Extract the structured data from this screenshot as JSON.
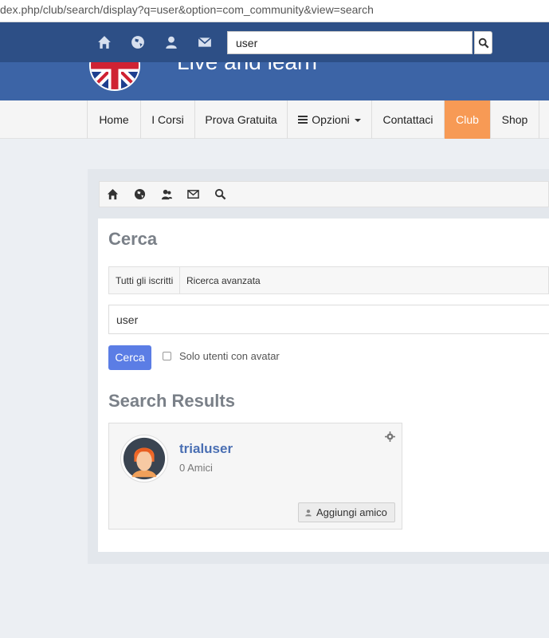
{
  "browser": {
    "url": "dex.php/club/search/display?q=user&option=com_community&view=search"
  },
  "topbar": {
    "icons": [
      "home-icon",
      "globe-icon",
      "user-icon",
      "mail-icon"
    ],
    "search_value": "user",
    "search_button_icon": "search-icon"
  },
  "brand": {
    "slogan": "Live and learn"
  },
  "nav": {
    "items": [
      {
        "label": "Home"
      },
      {
        "label": "I Corsi"
      },
      {
        "label": "Prova Gratuita"
      },
      {
        "label": "Opzioni"
      },
      {
        "label": "Contattaci"
      },
      {
        "label": "Club"
      },
      {
        "label": "Shop"
      }
    ],
    "active_color": "#f79a55"
  },
  "community_toolbar": {
    "icons": [
      "home-icon",
      "globe-icon",
      "friends-icon",
      "mail-icon",
      "search-icon"
    ]
  },
  "search": {
    "title": "Cerca",
    "tabs": [
      "Tutti gli iscritti",
      "Ricerca avanzata"
    ],
    "query": "user",
    "button_label": "Cerca",
    "avatar_only_label": "Solo utenti con avatar",
    "button_color": "#5b7de5"
  },
  "results": {
    "title": "Search Results",
    "items": [
      {
        "name": "trialuser",
        "friends": "0 Amici",
        "add_label": "Aggiungi amico"
      }
    ]
  }
}
